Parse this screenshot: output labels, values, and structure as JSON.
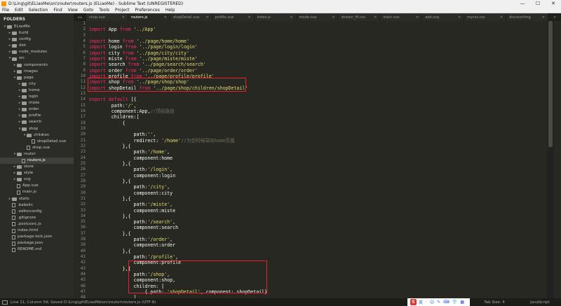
{
  "window": {
    "title": "D:\\Ling\\git\\ELiaoMe\\src\\router\\routers.js (ELiaoMe) - Sublime Text (UNREGISTERED)",
    "buttons": [
      "—",
      "☐",
      "✕"
    ]
  },
  "menu": [
    "File",
    "Edit",
    "Selection",
    "Find",
    "View",
    "Goto",
    "Tools",
    "Project",
    "Preferences",
    "Help"
  ],
  "sidebar": {
    "heading": "FOLDERS",
    "items": [
      {
        "label": "ELiaoMe",
        "type": "folder",
        "depth": 0,
        "open": true
      },
      {
        "label": "build",
        "type": "folder",
        "depth": 1,
        "open": false
      },
      {
        "label": "config",
        "type": "folder",
        "depth": 1,
        "open": false
      },
      {
        "label": "dist",
        "type": "folder",
        "depth": 1,
        "open": false
      },
      {
        "label": "node_modules",
        "type": "folder",
        "depth": 1,
        "open": false
      },
      {
        "label": "src",
        "type": "folder",
        "depth": 1,
        "open": true
      },
      {
        "label": "components",
        "type": "folder",
        "depth": 2,
        "open": false
      },
      {
        "label": "images",
        "type": "folder",
        "depth": 2,
        "open": false
      },
      {
        "label": "page",
        "type": "folder",
        "depth": 2,
        "open": true
      },
      {
        "label": "city",
        "type": "folder",
        "depth": 3,
        "open": false
      },
      {
        "label": "home",
        "type": "folder",
        "depth": 3,
        "open": false
      },
      {
        "label": "login",
        "type": "folder",
        "depth": 3,
        "open": false
      },
      {
        "label": "miste",
        "type": "folder",
        "depth": 3,
        "open": false
      },
      {
        "label": "order",
        "type": "folder",
        "depth": 3,
        "open": false
      },
      {
        "label": "profile",
        "type": "folder",
        "depth": 3,
        "open": false
      },
      {
        "label": "search",
        "type": "folder",
        "depth": 3,
        "open": false
      },
      {
        "label": "shop",
        "type": "folder",
        "depth": 3,
        "open": true
      },
      {
        "label": "children",
        "type": "folder",
        "depth": 4,
        "open": true
      },
      {
        "label": "shopDetail.vue",
        "type": "file",
        "depth": 5
      },
      {
        "label": "shop.vue",
        "type": "file",
        "depth": 4
      },
      {
        "label": "router",
        "type": "folder",
        "depth": 2,
        "open": true
      },
      {
        "label": "routers.js",
        "type": "file",
        "depth": 3,
        "active": true
      },
      {
        "label": "store",
        "type": "folder",
        "depth": 2,
        "open": false
      },
      {
        "label": "style",
        "type": "folder",
        "depth": 2,
        "open": false
      },
      {
        "label": "svg",
        "type": "folder",
        "depth": 2,
        "open": false
      },
      {
        "label": "App.vue",
        "type": "file",
        "depth": 2
      },
      {
        "label": "main.js",
        "type": "file",
        "depth": 2
      },
      {
        "label": "static",
        "type": "folder",
        "depth": 1,
        "open": false
      },
      {
        "label": ".babelrc",
        "type": "file",
        "depth": 1
      },
      {
        "label": ".editorconfig",
        "type": "file",
        "depth": 1
      },
      {
        "label": ".gitignore",
        "type": "file",
        "depth": 1
      },
      {
        "label": ".postcssrc.js",
        "type": "file",
        "depth": 1
      },
      {
        "label": "index.html",
        "type": "file",
        "depth": 1
      },
      {
        "label": "package-lock.json",
        "type": "file",
        "depth": 1
      },
      {
        "label": "package.json",
        "type": "file",
        "depth": 1
      },
      {
        "label": "README.md",
        "type": "file",
        "depth": 1
      }
    ]
  },
  "tabs": [
    {
      "label": "shop.vue",
      "active": false
    },
    {
      "label": "routers.js",
      "active": true
    },
    {
      "label": "shopDetail.vue",
      "active": false
    },
    {
      "label": "profile.vue",
      "active": false
    },
    {
      "label": "index.js",
      "active": false
    },
    {
      "label": "mode.vue",
      "active": false
    },
    {
      "label": "stream_fit.css",
      "active": false
    },
    {
      "label": "main.vue",
      "active": false
    },
    {
      "label": "add.svg",
      "active": false
    },
    {
      "label": "mycss.css",
      "active": false
    },
    {
      "label": "discountimg",
      "active": false
    }
  ],
  "code_lines": [
    [],
    [
      [
        "kw",
        "import"
      ],
      [
        "plain",
        " App "
      ],
      [
        "kw",
        "from"
      ],
      [
        "str",
        " '../App'"
      ]
    ],
    [],
    [
      [
        "kw",
        "import"
      ],
      [
        "plain",
        " home "
      ],
      [
        "kw",
        "from"
      ],
      [
        "str",
        " '../page/home/home'"
      ]
    ],
    [
      [
        "kw",
        "import"
      ],
      [
        "plain",
        " login "
      ],
      [
        "kw",
        "from"
      ],
      [
        "str",
        " '../page/login/login'"
      ]
    ],
    [
      [
        "kw",
        "import"
      ],
      [
        "plain",
        " city "
      ],
      [
        "kw",
        "from"
      ],
      [
        "str",
        " '../page/city/city'"
      ]
    ],
    [
      [
        "kw",
        "import"
      ],
      [
        "plain",
        " miste "
      ],
      [
        "kw",
        "from"
      ],
      [
        "str",
        " '../page/miste/miste'"
      ]
    ],
    [
      [
        "kw",
        "import"
      ],
      [
        "plain",
        " search "
      ],
      [
        "kw",
        "from"
      ],
      [
        "str",
        " '../page/search/search'"
      ]
    ],
    [
      [
        "kw",
        "import"
      ],
      [
        "plain",
        " order "
      ],
      [
        "kw",
        "from"
      ],
      [
        "str",
        " '../page/order/order'"
      ]
    ],
    [
      [
        "kw",
        "import"
      ],
      [
        "plain",
        " profile "
      ],
      [
        "kw",
        "from"
      ],
      [
        "str",
        " '../page/profile/profile'"
      ]
    ],
    [
      [
        "kw",
        "import"
      ],
      [
        "plain",
        " shop "
      ],
      [
        "kw",
        "from"
      ],
      [
        "str",
        " '../page/shop/shop'"
      ]
    ],
    [
      [
        "kw",
        "import"
      ],
      [
        "plain",
        " shopDetail "
      ],
      [
        "kw",
        "from"
      ],
      [
        "str",
        " '../page/shop/children/shopDetail'"
      ]
    ],
    [],
    [
      [
        "kw",
        "export default"
      ],
      [
        "plain",
        " [{"
      ]
    ],
    [
      [
        "plain",
        "        path:"
      ],
      [
        "str",
        "'/'"
      ],
      [
        "plain",
        ","
      ]
    ],
    [
      [
        "plain",
        "        component:App,"
      ],
      [
        "cmt",
        "//顶层路由"
      ]
    ],
    [
      [
        "plain",
        "        children:["
      ]
    ],
    [
      [
        "plain",
        "            {"
      ]
    ],
    [],
    [
      [
        "plain",
        "                path:"
      ],
      [
        "str",
        "''"
      ],
      [
        "plain",
        ","
      ]
    ],
    [
      [
        "plain",
        "                redirect: "
      ],
      [
        "str",
        "'/home'"
      ],
      [
        "cmt",
        "//为空时候导向home页面"
      ]
    ],
    [
      [
        "plain",
        "            },{"
      ]
    ],
    [
      [
        "plain",
        "                path:"
      ],
      [
        "str",
        "'/home'"
      ],
      [
        "plain",
        ","
      ]
    ],
    [
      [
        "plain",
        "                component:home"
      ]
    ],
    [
      [
        "plain",
        "            },{"
      ]
    ],
    [
      [
        "plain",
        "                path:"
      ],
      [
        "str",
        "'/login'"
      ],
      [
        "plain",
        ","
      ]
    ],
    [
      [
        "plain",
        "                component:login"
      ]
    ],
    [
      [
        "plain",
        "            },{"
      ]
    ],
    [
      [
        "plain",
        "                path:"
      ],
      [
        "str",
        "'/city'"
      ],
      [
        "plain",
        ","
      ]
    ],
    [
      [
        "plain",
        "                component:city"
      ]
    ],
    [
      [
        "plain",
        "            },{"
      ]
    ],
    [
      [
        "plain",
        "                path:"
      ],
      [
        "str",
        "'/miste'"
      ],
      [
        "plain",
        ","
      ]
    ],
    [
      [
        "plain",
        "                component:miste"
      ]
    ],
    [
      [
        "plain",
        "            },{"
      ]
    ],
    [
      [
        "plain",
        "                path:"
      ],
      [
        "str",
        "'/search'"
      ],
      [
        "plain",
        ","
      ]
    ],
    [
      [
        "plain",
        "                component:search"
      ]
    ],
    [
      [
        "plain",
        "            },{"
      ]
    ],
    [
      [
        "plain",
        "                path:"
      ],
      [
        "str",
        "'/order'"
      ],
      [
        "plain",
        ","
      ]
    ],
    [
      [
        "plain",
        "                component:order"
      ]
    ],
    [
      [
        "plain",
        "            },{"
      ]
    ],
    [
      [
        "plain",
        "                path:"
      ],
      [
        "str",
        "'/profile'"
      ],
      [
        "plain",
        ","
      ]
    ],
    [
      [
        "plain",
        "                component:profile"
      ]
    ],
    [
      [
        "plain",
        "            },{"
      ]
    ],
    [
      [
        "plain",
        "                path:"
      ],
      [
        "str",
        "'/shop'"
      ],
      [
        "plain",
        ","
      ]
    ],
    [
      [
        "plain",
        "                component:shop,"
      ]
    ],
    [
      [
        "plain",
        "                children: ["
      ]
    ],
    [
      [
        "plain",
        "                    { path: "
      ],
      [
        "str",
        "'shopDetail'"
      ],
      [
        "plain",
        ", component: shopDetail}"
      ]
    ],
    [
      [
        "plain",
        "                ]"
      ]
    ],
    [
      [
        "plain",
        "            }"
      ]
    ]
  ],
  "status": {
    "text": "Line 11, Column 59; Saved D:\\Ling\\git\\ELiaoMe\\src\\router\\routers.js (UTF-8)",
    "ime_logo": "S",
    "ime_items": [
      "英",
      "·",
      "☺",
      "✎",
      "⌨",
      "👕",
      "▦"
    ],
    "tab_size": "Tab Size: 4",
    "syntax": "JavaScript"
  },
  "colors": {
    "keyword": "#f92672",
    "string": "#e6db74",
    "comment": "#75715e",
    "highlight_box": "#e8212e"
  }
}
